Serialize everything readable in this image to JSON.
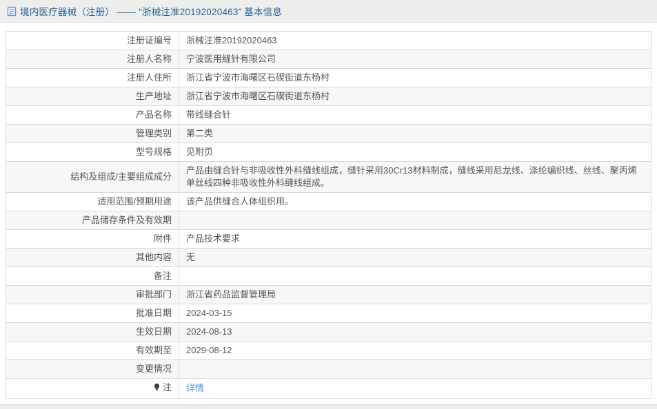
{
  "header": {
    "title": "境内医疗器械（注册） ——  “浙械注准20192020463”  基本信息",
    "icon": "document-icon"
  },
  "colors": {
    "title_blue": "#2a6496",
    "link_blue": "#4a90d9",
    "strip_bg": "#ededec",
    "alt_row_bg": "#f7f7f7",
    "border": "#d8d8d8",
    "text": "#555555"
  },
  "table": {
    "rows": [
      {
        "label": "注册证编号",
        "value": "浙械注准20192020463"
      },
      {
        "label": "注册人名称",
        "value": "宁波医用缝针有限公司"
      },
      {
        "label": "注册人住所",
        "value": "浙江省宁波市海曙区石碶街道东杨村"
      },
      {
        "label": "生产地址",
        "value": "浙江省宁波市海曙区石碶街道东杨村"
      },
      {
        "label": "产品名称",
        "value": "带线缝合针"
      },
      {
        "label": "管理类别",
        "value": "第二类"
      },
      {
        "label": "型号规格",
        "value": "见附页"
      },
      {
        "label": "结构及组成/主要组成成分",
        "value": "产品由缝合针与非吸收性外科缝线组成，缝针采用30Cr13材料制成，缝线采用尼龙线、涤纶编织线、丝线、聚丙烯单丝线四种非吸收性外科缝线组成。"
      },
      {
        "label": "适用范围/预期用途",
        "value": "该产品供缝合人体组织用。"
      },
      {
        "label": "产品储存条件及有效期",
        "value": ""
      },
      {
        "label": "附件",
        "value": "产品技术要求"
      },
      {
        "label": "其他内容",
        "value": "无"
      },
      {
        "label": "备注",
        "value": ""
      },
      {
        "label": "审批部门",
        "value": "浙江省药品监督管理局"
      },
      {
        "label": "批准日期",
        "value": "2024-03-15"
      },
      {
        "label": "生效日期",
        "value": "2024-08-13"
      },
      {
        "label": "有效期至",
        "value": "2029-08-12"
      },
      {
        "label": "变更情况",
        "value": ""
      },
      {
        "label": "注",
        "value": "详情",
        "value_type": "link",
        "label_icon": "bulb-icon"
      }
    ]
  }
}
